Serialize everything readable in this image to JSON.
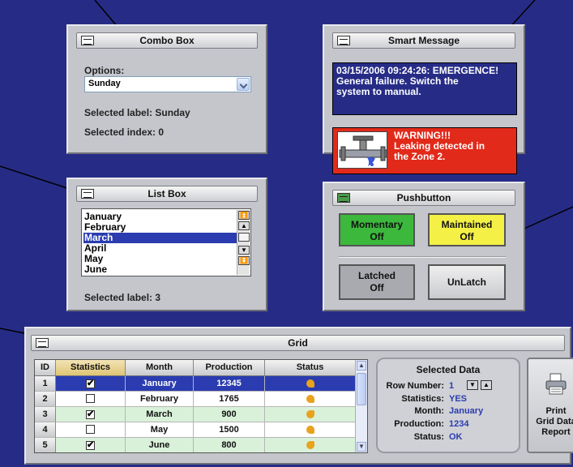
{
  "combo_panel": {
    "title": "Combo Box",
    "options_label": "Options:",
    "selected_value": "Sunday",
    "selected_label_text": "Selected label: Sunday",
    "selected_index_text": "Selected index: 0"
  },
  "smart_message": {
    "title": "Smart Message",
    "message_line1": "03/15/2006 09:24:26: EMERGENCE!",
    "message_line2": "General failure. Switch the",
    "message_line3": "system to manual.",
    "warning_line1": "WARNING!!!",
    "warning_line2": "Leaking detected in",
    "warning_line3": "the Zone 2."
  },
  "list_box": {
    "title": "List Box",
    "items": [
      "January",
      "February",
      "March",
      "April",
      "May",
      "June"
    ],
    "selected_item": "March",
    "selected_label_text": "Selected label: 3"
  },
  "pushbutton": {
    "title": "Pushbutton",
    "momentary": {
      "label": "Momentary",
      "state": "Off",
      "color": "#3cb83c"
    },
    "maintained": {
      "label": "Maintained",
      "state": "Off",
      "color": "#f4f046"
    },
    "latched": {
      "label": "Latched",
      "state": "Off",
      "color": "#a9aaaf"
    },
    "unlatch": {
      "label": "UnLatch"
    }
  },
  "grid": {
    "title": "Grid",
    "columns": [
      "ID",
      "Statistics",
      "Month",
      "Production",
      "Status"
    ],
    "rows": [
      {
        "id": "1",
        "statistics": true,
        "month": "January",
        "production": "12345",
        "selected": true
      },
      {
        "id": "2",
        "statistics": false,
        "month": "February",
        "production": "1765",
        "selected": false
      },
      {
        "id": "3",
        "statistics": true,
        "month": "March",
        "production": "900",
        "selected": false
      },
      {
        "id": "4",
        "statistics": false,
        "month": "May",
        "production": "1500",
        "selected": false
      },
      {
        "id": "5",
        "statistics": true,
        "month": "June",
        "production": "800",
        "selected": false
      }
    ],
    "selected_data": {
      "title": "Selected Data",
      "row_number_label": "Row Number:",
      "row_number_value": "1",
      "statistics_label": "Statistics:",
      "statistics_value": "YES",
      "month_label": "Month:",
      "month_value": "January",
      "production_label": "Production:",
      "production_value": "1234",
      "status_label": "Status:",
      "status_value": "OK"
    },
    "print_button": {
      "line1": "Print",
      "line2": "Grid Data",
      "line3": "Report"
    }
  },
  "colors": {
    "background": "#262c86",
    "panel": "#c4c6cc",
    "selection": "#2a3cb0",
    "warning": "#e22a1a",
    "value_text": "#2a3cb0"
  },
  "check_glyph": "✔",
  "icons": {
    "scroll_up": "▲",
    "scroll_down": "▼",
    "page_up": "⏫",
    "page_down": "⏬"
  }
}
